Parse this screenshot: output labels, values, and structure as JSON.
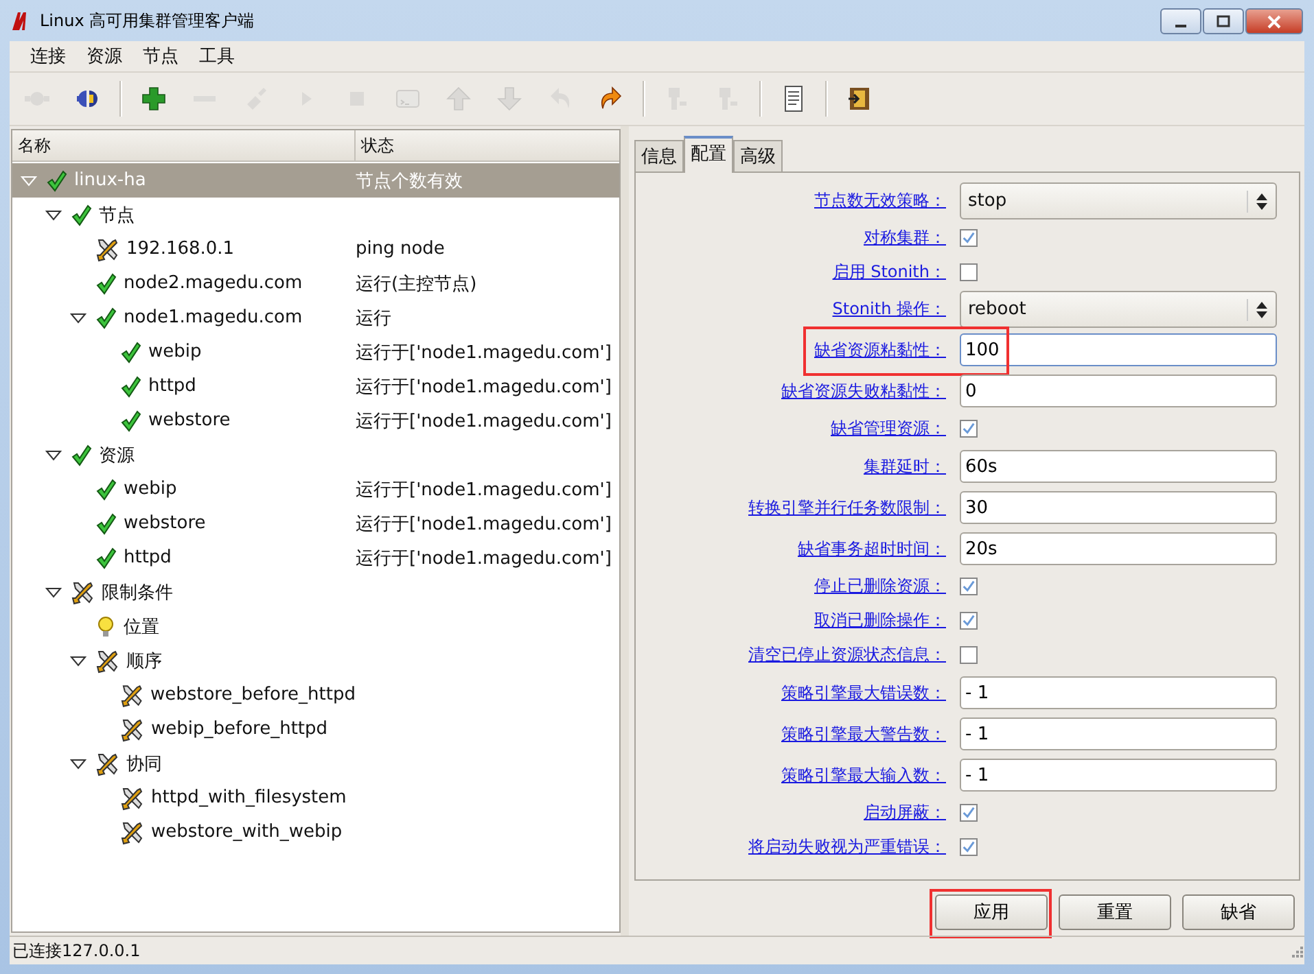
{
  "window": {
    "title": "Linux 高可用集群管理客户端"
  },
  "menu": [
    "连接",
    "资源",
    "节点",
    "工具"
  ],
  "toolbar": [
    [
      {
        "kind": "plug",
        "disabled": true
      },
      {
        "kind": "connect",
        "disabled": false
      }
    ],
    [
      {
        "kind": "add",
        "disabled": false
      },
      {
        "kind": "remove",
        "disabled": true
      },
      {
        "kind": "broom",
        "disabled": true
      },
      {
        "kind": "play",
        "disabled": true
      },
      {
        "kind": "stop",
        "disabled": true
      },
      {
        "kind": "terminal",
        "disabled": true
      },
      {
        "kind": "up",
        "disabled": true
      },
      {
        "kind": "down",
        "disabled": true
      },
      {
        "kind": "undo",
        "disabled": true
      },
      {
        "kind": "redo",
        "disabled": false
      }
    ],
    [
      {
        "kind": "node-a",
        "disabled": true
      },
      {
        "kind": "node-b",
        "disabled": true
      }
    ],
    [
      {
        "kind": "document",
        "disabled": false
      }
    ],
    [
      {
        "kind": "exit",
        "disabled": false
      }
    ]
  ],
  "tree": {
    "columns": [
      "名称",
      "状态"
    ],
    "rows": [
      {
        "name": "linux-ha",
        "status": "节点个数有效",
        "kind": "ok",
        "expanded": true,
        "selected": true,
        "children": [
          {
            "name": "节点",
            "kind": "ok",
            "expanded": true,
            "selected": false,
            "children": [
              {
                "name": "192.168.0.1",
                "status": "ping node",
                "kind": "tool",
                "selected": false
              },
              {
                "name": "node2.magedu.com",
                "status": "运行(主控节点)",
                "kind": "ok",
                "selected": false
              },
              {
                "name": "node1.magedu.com",
                "status": "运行",
                "kind": "ok",
                "expanded": true,
                "selected": false,
                "children": [
                  {
                    "name": "webip",
                    "status": "运行于['node1.magedu.com']",
                    "kind": "ok",
                    "selected": false
                  },
                  {
                    "name": "httpd",
                    "status": "运行于['node1.magedu.com']",
                    "kind": "ok",
                    "selected": false
                  },
                  {
                    "name": "webstore",
                    "status": "运行于['node1.magedu.com']",
                    "kind": "ok",
                    "selected": false
                  }
                ]
              }
            ]
          },
          {
            "name": "资源",
            "kind": "ok",
            "expanded": true,
            "selected": false,
            "children": [
              {
                "name": "webip",
                "status": "运行于['node1.magedu.com']",
                "kind": "ok",
                "selected": false
              },
              {
                "name": "webstore",
                "status": "运行于['node1.magedu.com']",
                "kind": "ok",
                "selected": false
              },
              {
                "name": "httpd",
                "status": "运行于['node1.magedu.com']",
                "kind": "ok",
                "selected": false
              }
            ]
          },
          {
            "name": "限制条件",
            "kind": "tool",
            "expanded": true,
            "selected": false,
            "children": [
              {
                "name": "位置",
                "kind": "bulb",
                "selected": false
              },
              {
                "name": "顺序",
                "kind": "tool",
                "expanded": true,
                "selected": false,
                "children": [
                  {
                    "name": "webstore_before_httpd",
                    "kind": "tool",
                    "selected": false
                  },
                  {
                    "name": "webip_before_httpd",
                    "kind": "tool",
                    "selected": false
                  }
                ]
              },
              {
                "name": "协同",
                "kind": "tool",
                "expanded": true,
                "selected": false,
                "children": [
                  {
                    "name": "httpd_with_filesystem",
                    "kind": "tool",
                    "selected": false
                  },
                  {
                    "name": "webstore_with_webip",
                    "kind": "tool",
                    "selected": false
                  }
                ]
              }
            ]
          }
        ]
      }
    ]
  },
  "tabs": [
    {
      "label": "信息",
      "selected": false
    },
    {
      "label": "配置",
      "selected": true
    },
    {
      "label": "高级",
      "selected": false
    }
  ],
  "fields": [
    {
      "label": "节点数无效策略：",
      "kind": "select",
      "value": "stop"
    },
    {
      "label": "对称集群：",
      "kind": "checkbox",
      "checked": true
    },
    {
      "label": "启用 Stonith：",
      "kind": "checkbox",
      "checked": false
    },
    {
      "label": "Stonith 操作：",
      "kind": "select",
      "value": "reboot"
    },
    {
      "label": "缺省资源粘黏性：",
      "kind": "text",
      "value": "100",
      "focused": true,
      "highlighted": true
    },
    {
      "label": "缺省资源失败粘黏性：",
      "kind": "text",
      "value": "0"
    },
    {
      "label": "缺省管理资源：",
      "kind": "checkbox",
      "checked": true
    },
    {
      "label": "集群延时：",
      "kind": "text",
      "value": "60s"
    },
    {
      "label": "转换引擎并行任务数限制：",
      "kind": "text",
      "value": "30"
    },
    {
      "label": "缺省事务超时时间：",
      "kind": "text",
      "value": "20s"
    },
    {
      "label": "停止已删除资源：",
      "kind": "checkbox",
      "checked": true
    },
    {
      "label": "取消已删除操作：",
      "kind": "checkbox",
      "checked": true
    },
    {
      "label": "清空已停止资源状态信息：",
      "kind": "checkbox",
      "checked": false
    },
    {
      "label": "策略引擎最大错误数：",
      "kind": "text",
      "value": "- 1"
    },
    {
      "label": "策略引擎最大警告数：",
      "kind": "text",
      "value": "- 1"
    },
    {
      "label": "策略引擎最大输入数：",
      "kind": "text",
      "value": "- 1"
    },
    {
      "label": "启动屏蔽：",
      "kind": "checkbox",
      "checked": true
    },
    {
      "label": "将启动失败视为严重错误：",
      "kind": "checkbox",
      "checked": true
    }
  ],
  "buttons": [
    {
      "label": "应用",
      "highlighted": true
    },
    {
      "label": "重置",
      "highlighted": false
    },
    {
      "label": "缺省",
      "highlighted": false
    }
  ],
  "status_bar": "已连接127.0.0.1"
}
